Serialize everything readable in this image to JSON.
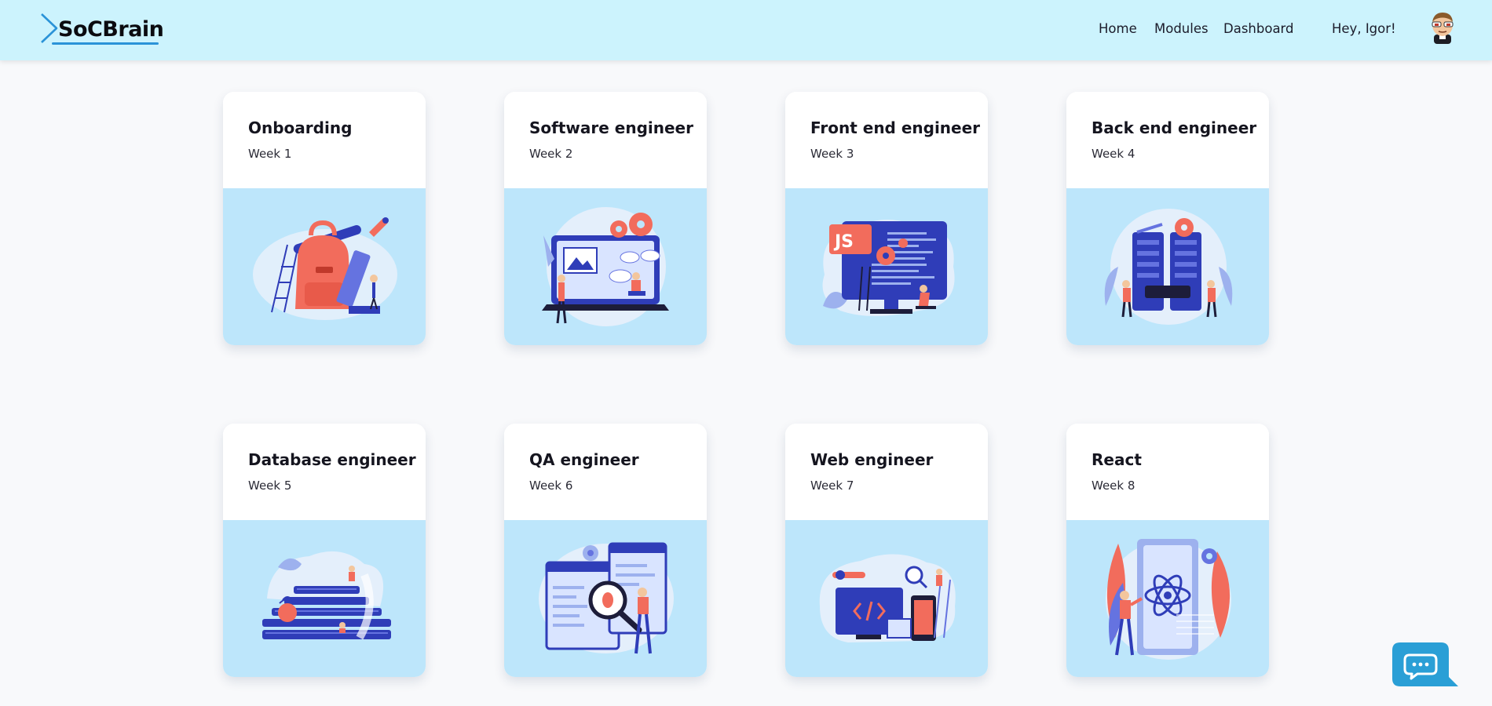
{
  "header": {
    "logo_text": "SoCBrain",
    "nav": [
      {
        "label": "Home"
      },
      {
        "label": "Modules"
      },
      {
        "label": "Dashboard"
      }
    ],
    "greeting": "Hey, Igor!",
    "avatar_icon": "cartoon-avatar"
  },
  "cards": [
    {
      "title": "Onboarding",
      "week": "Week 1",
      "illustration": "backpack-rocket-illustration"
    },
    {
      "title": "Software engineer",
      "week": "Week 2",
      "illustration": "laptop-gears-illustration"
    },
    {
      "title": "Front end engineer",
      "week": "Week 3",
      "illustration": "js-monitor-illustration"
    },
    {
      "title": "Back end engineer",
      "week": "Week 4",
      "illustration": "server-robot-illustration"
    },
    {
      "title": "Database engineer",
      "week": "Week 5",
      "illustration": "database-stack-illustration"
    },
    {
      "title": "QA engineer",
      "week": "Week 6",
      "illustration": "magnifier-bug-illustration"
    },
    {
      "title": "Web engineer",
      "week": "Week 7",
      "illustration": "web-devices-illustration"
    },
    {
      "title": "React",
      "week": "Week 8",
      "illustration": "react-atom-illustration"
    }
  ],
  "chat": {
    "icon": "chat-bubble-icon"
  },
  "colors": {
    "header_bg": "#ccf3fd",
    "card_image_bg": "#bde6fb",
    "accent_blue": "#2f3db8",
    "accent_coral": "#f26c5c",
    "chat_button": "#2a9fd6"
  }
}
